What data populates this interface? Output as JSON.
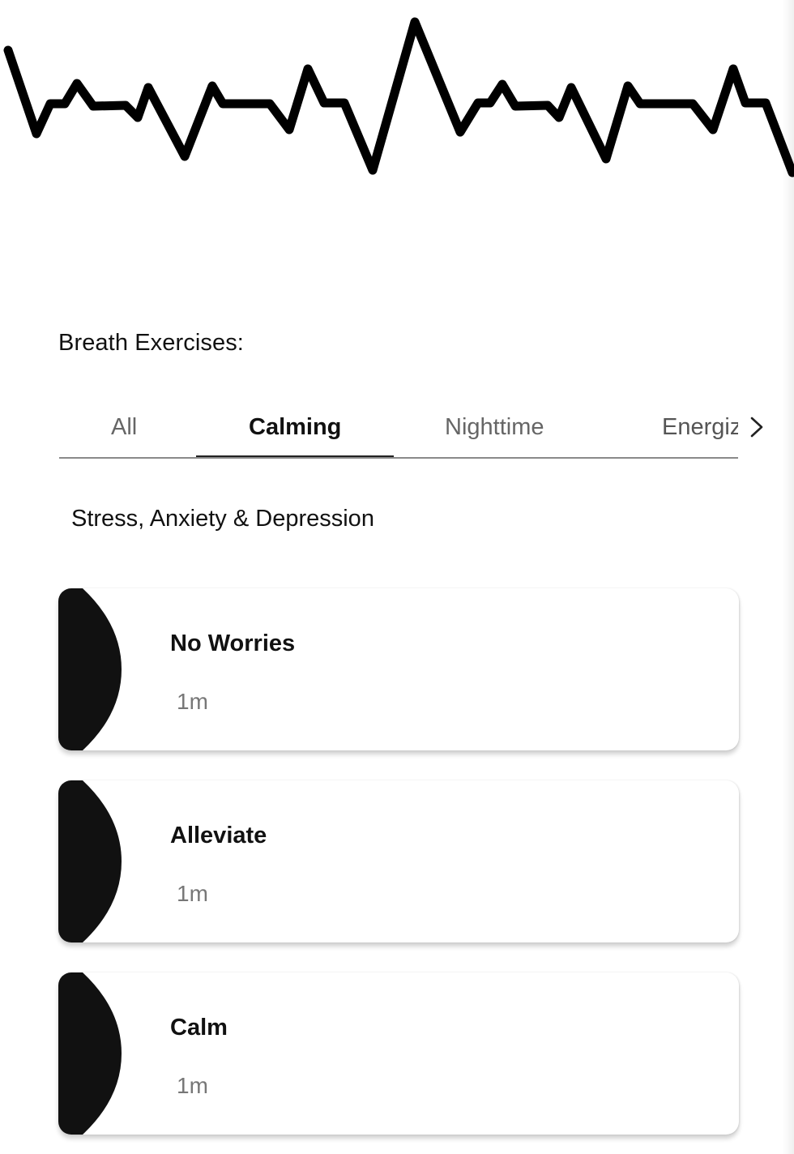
{
  "header": {
    "graphic_icon": "heartbeat-line-icon"
  },
  "section_title": "Breath Exercises:",
  "tabs": [
    {
      "label": "All",
      "active": false
    },
    {
      "label": "Calming",
      "active": true
    },
    {
      "label": "Nighttime",
      "active": false
    },
    {
      "label": "Energiz",
      "active": false
    }
  ],
  "tabs_more_icon": "chevron-right-icon",
  "group_title": "Stress, Anxiety & Depression",
  "exercises": [
    {
      "name": "No Worries",
      "duration": "1m",
      "thumb_icon": "half-circle-icon"
    },
    {
      "name": "Alleviate",
      "duration": "1m",
      "thumb_icon": "half-circle-icon"
    },
    {
      "name": "Calm",
      "duration": "1m",
      "thumb_icon": "half-circle-icon"
    }
  ],
  "colors": {
    "text": "#111111",
    "muted": "#777777",
    "line": "#000000",
    "background": "#ffffff"
  }
}
